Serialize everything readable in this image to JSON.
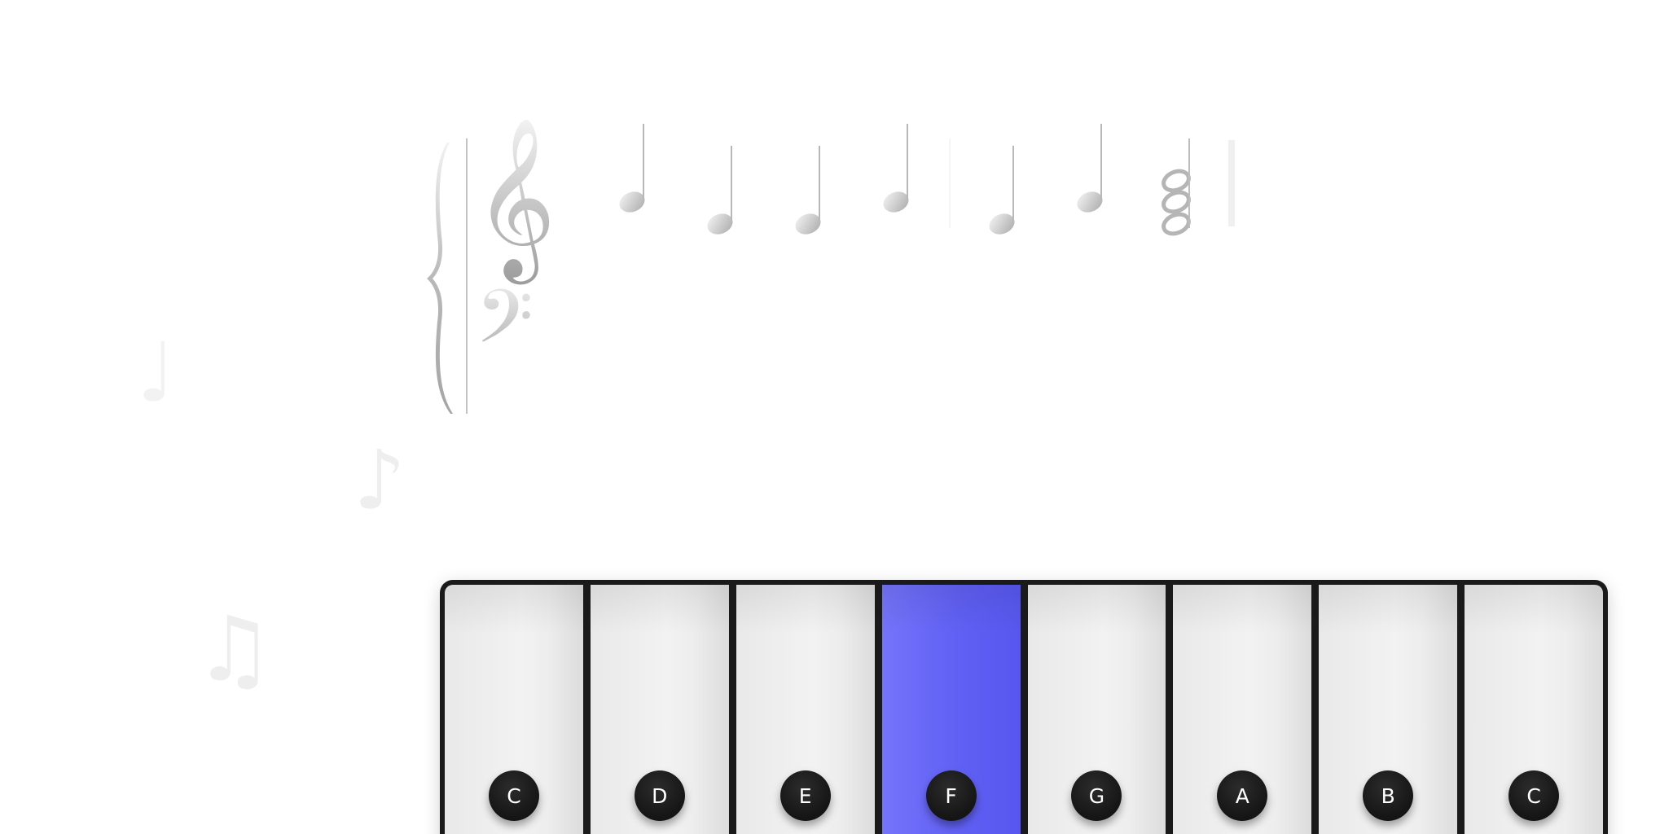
{
  "score": {
    "clefs": [
      "treble-clef",
      "bass-clef"
    ],
    "treble_notes": [
      {
        "pitch": "C5",
        "duration": "quarter"
      },
      {
        "pitch": "A4",
        "duration": "quarter"
      },
      {
        "pitch": "A4",
        "duration": "quarter"
      },
      {
        "pitch": "C5",
        "duration": "quarter"
      },
      {
        "pitch": "A4",
        "duration": "quarter"
      },
      {
        "pitch": "C5",
        "duration": "quarter"
      }
    ],
    "final_chord": {
      "pitches": [
        "C5",
        "A4",
        "F4"
      ],
      "duration": "half"
    }
  },
  "decorations": {
    "note_1": "♩",
    "note_2": "♪",
    "note_3": "♫"
  },
  "keyboard": {
    "active_key": "F",
    "accent_color": "#6262f5",
    "keys": [
      {
        "label": "C"
      },
      {
        "label": "D"
      },
      {
        "label": "E"
      },
      {
        "label": "F"
      },
      {
        "label": "G"
      },
      {
        "label": "A"
      },
      {
        "label": "B"
      },
      {
        "label": "C"
      }
    ]
  }
}
